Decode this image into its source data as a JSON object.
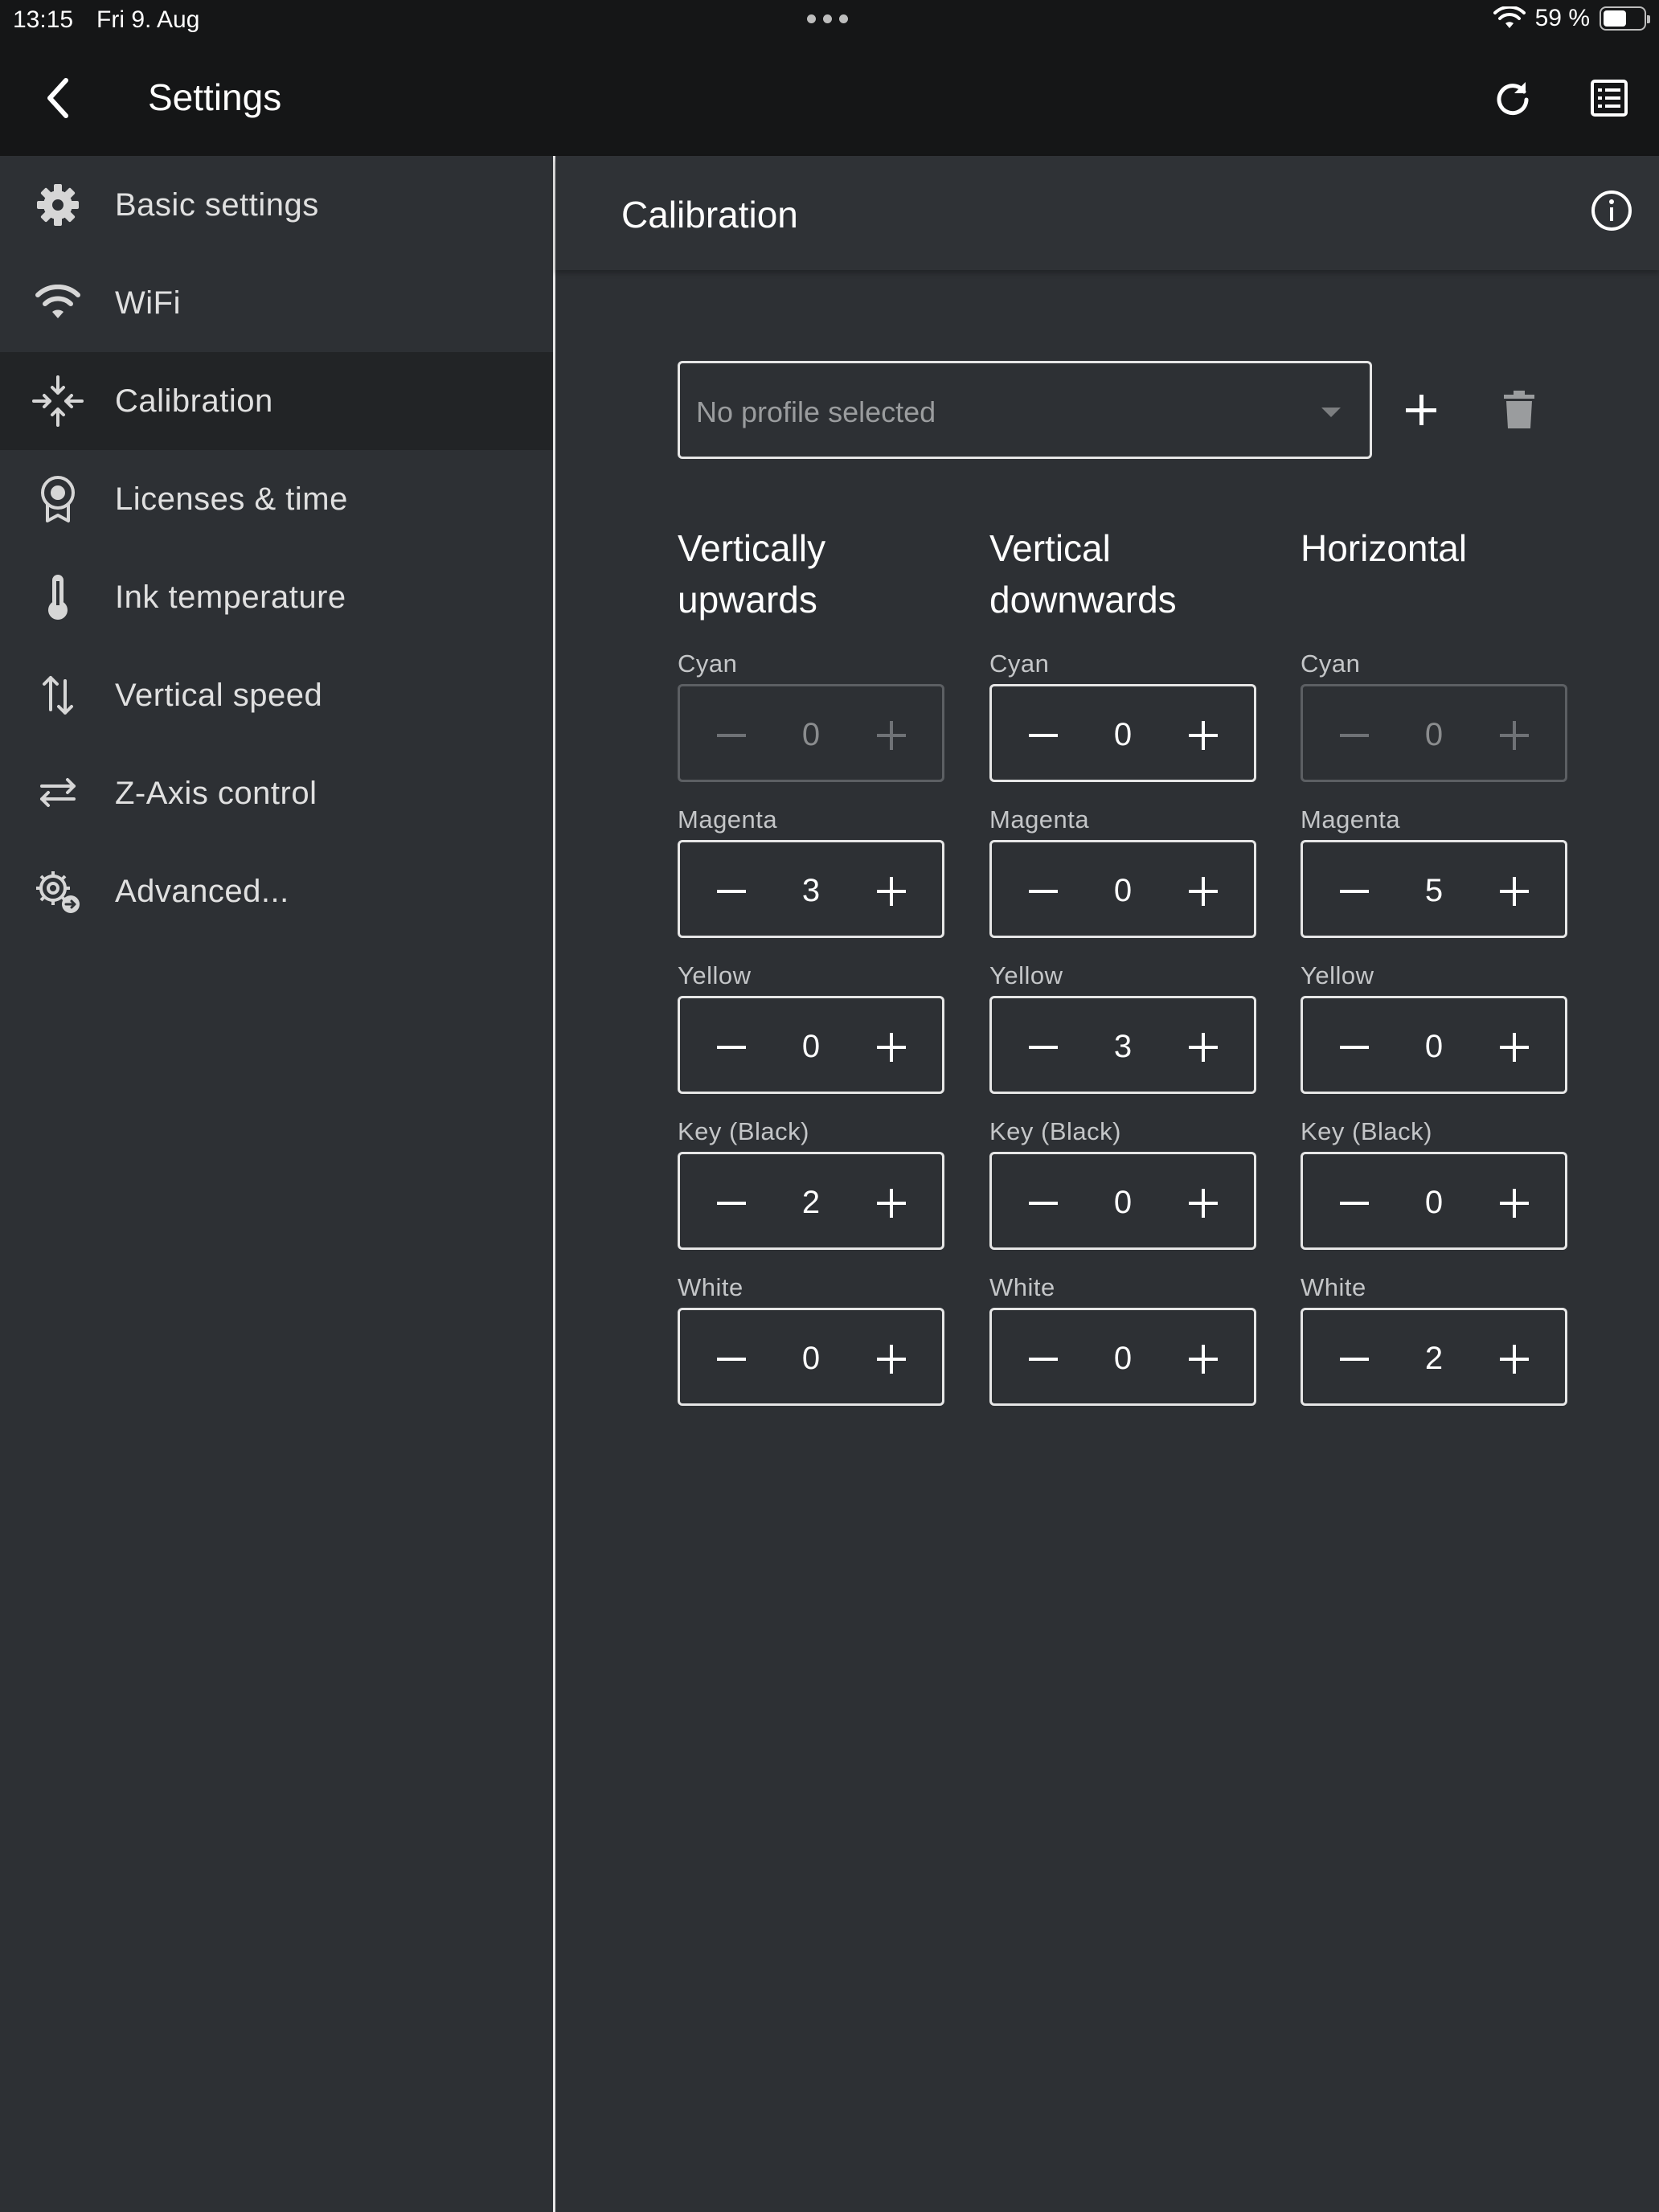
{
  "status_bar": {
    "time": "13:15",
    "date": "Fri 9. Aug",
    "battery": "59 %"
  },
  "header": {
    "title": "Settings"
  },
  "sidebar": {
    "items": [
      {
        "label": "Basic settings",
        "icon": "gear-icon"
      },
      {
        "label": "WiFi",
        "icon": "wifi-icon"
      },
      {
        "label": "Calibration",
        "icon": "calibration-arrows-icon",
        "active": true
      },
      {
        "label": "Licenses & time",
        "icon": "license-badge-icon"
      },
      {
        "label": "Ink temperature",
        "icon": "thermometer-icon"
      },
      {
        "label": "Vertical speed",
        "icon": "up-down-arrows-icon"
      },
      {
        "label": "Z-Axis control",
        "icon": "left-right-arrows-icon"
      },
      {
        "label": "Advanced...",
        "icon": "advanced-gear-icon"
      }
    ]
  },
  "panel": {
    "title": "Calibration",
    "profile_placeholder": "No profile selected",
    "columns": [
      {
        "heading_line1": "Vertically",
        "heading_line2": "upwards",
        "fields": [
          {
            "label": "Cyan",
            "value": "0",
            "disabled": true
          },
          {
            "label": "Magenta",
            "value": "3",
            "disabled": false
          },
          {
            "label": "Yellow",
            "value": "0",
            "disabled": false
          },
          {
            "label": "Key (Black)",
            "value": "2",
            "disabled": false
          },
          {
            "label": "White",
            "value": "0",
            "disabled": false
          }
        ]
      },
      {
        "heading_line1": "Vertical",
        "heading_line2": "downwards",
        "fields": [
          {
            "label": "Cyan",
            "value": "0",
            "disabled": false
          },
          {
            "label": "Magenta",
            "value": "0",
            "disabled": false
          },
          {
            "label": "Yellow",
            "value": "3",
            "disabled": false
          },
          {
            "label": "Key (Black)",
            "value": "0",
            "disabled": false
          },
          {
            "label": "White",
            "value": "0",
            "disabled": false
          }
        ]
      },
      {
        "heading_line1": "Horizontal",
        "heading_line2": "",
        "fields": [
          {
            "label": "Cyan",
            "value": "0",
            "disabled": true
          },
          {
            "label": "Magenta",
            "value": "5",
            "disabled": false
          },
          {
            "label": "Yellow",
            "value": "0",
            "disabled": false
          },
          {
            "label": "Key (Black)",
            "value": "0",
            "disabled": false
          },
          {
            "label": "White",
            "value": "2",
            "disabled": false
          }
        ]
      }
    ]
  },
  "colors": {
    "background": "#2d3034",
    "topbar": "#151617",
    "active_item": "#222426",
    "border": "#e6e6e6"
  }
}
